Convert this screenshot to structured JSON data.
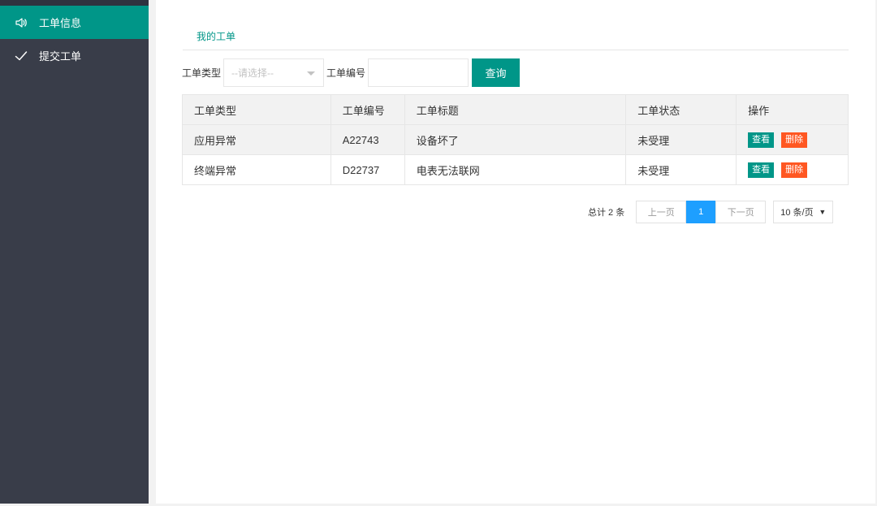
{
  "sidebar": {
    "items": [
      {
        "label": "工单信息",
        "icon": "speaker-icon",
        "active": true
      },
      {
        "label": "提交工单",
        "icon": "check-icon",
        "active": false
      }
    ]
  },
  "tabs": {
    "my_orders": "我的工单"
  },
  "search": {
    "type_label": "工单类型",
    "type_placeholder": "--请选择--",
    "number_label": "工单编号",
    "number_value": "",
    "query_button": "查询"
  },
  "table": {
    "headers": [
      "工单类型",
      "工单编号",
      "工单标题",
      "工单状态",
      "操作"
    ],
    "rows": [
      {
        "type": "应用异常",
        "number": "A22743",
        "title": "设备坏了",
        "status": "未受理",
        "view": "查看",
        "delete": "删除"
      },
      {
        "type": "终端异常",
        "number": "D22737",
        "title": "电表无法联网",
        "status": "未受理",
        "view": "查看",
        "delete": "删除"
      }
    ]
  },
  "pagination": {
    "total": "总计 2 条",
    "prev": "上一页",
    "current": "1",
    "next": "下一页",
    "page_size": "10 条/页"
  },
  "colors": {
    "accent": "#009688",
    "sidebar_bg": "#393d49",
    "delete": "#ff5722",
    "pager_active": "#1e9fff"
  }
}
